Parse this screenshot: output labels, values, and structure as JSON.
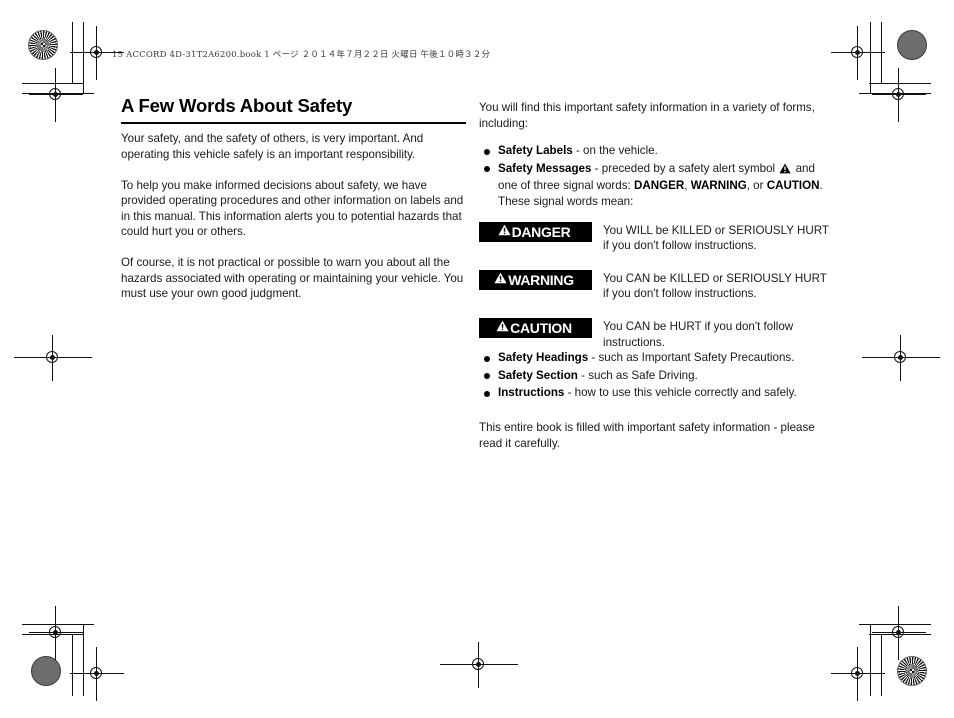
{
  "print_slug": {
    "text": "15 ACCORD 4D-31T2A6200.book  1 ページ  ２０１４年７月２２日  火曜日  午後１０時３２分"
  },
  "left_column": {
    "title": "A Few Words About Safety",
    "paragraphs": [
      "Your safety, and the safety of others, is very important. And operating this vehicle safely is an important responsibility.",
      "To help you make informed decisions about safety, we have provided operating procedures and other information on labels and in this manual. This information alerts you to potential hazards that could hurt you or others.",
      "Of course, it is not practical or possible to warn you about all the hazards associated with operating or maintaining your vehicle. You must use your own good judgment."
    ]
  },
  "right_column": {
    "lead": "You will find this important safety information in a variety of forms, including:",
    "forms_bullets": [
      {
        "term": "Safety Labels",
        "rest": " - on the vehicle."
      },
      {
        "term": "Safety Messages",
        "rest_before_icon": " - preceded by a safety alert symbol ",
        "icon": "safety-alert-triangle-icon",
        "rest_after_icon": " and one of three signal words: ",
        "signal_words": [
          "DANGER",
          "WARNING",
          "CAUTION"
        ],
        "rest_tail": ". These signal words mean:"
      }
    ],
    "signals": [
      {
        "word": "DANGER",
        "icon": "safety-alert-triangle-icon",
        "description": "You WILL be KILLED or SERIOUSLY HURT if you don't follow instructions.",
        "background": "#000000",
        "foreground": "#FFFFFF"
      },
      {
        "word": "WARNING",
        "icon": "safety-alert-triangle-icon",
        "description": "You CAN be KILLED or SERIOUSLY HURT if you don't follow instructions.",
        "background": "#000000",
        "foreground": "#FFFFFF"
      },
      {
        "word": "CAUTION",
        "icon": "safety-alert-triangle-icon",
        "description": "You CAN be HURT if you don't follow instructions.",
        "background": "#000000",
        "foreground": "#FFFFFF"
      }
    ],
    "kinds_bullets": [
      {
        "term": "Safety Headings",
        "rest": " - such as Important Safety Precautions."
      },
      {
        "term": "Safety Section",
        "rest": " - such as Safe Driving."
      },
      {
        "term": "Instructions",
        "rest": " - how to use this vehicle correctly and safely."
      }
    ],
    "closing": "This entire book is filled with important safety information - please read it carefully."
  },
  "prepress": {
    "registration_mark": "registration-target-icon",
    "star_target": "halftone-star-target-icon",
    "solid_target": "solid-density-patch-icon"
  }
}
